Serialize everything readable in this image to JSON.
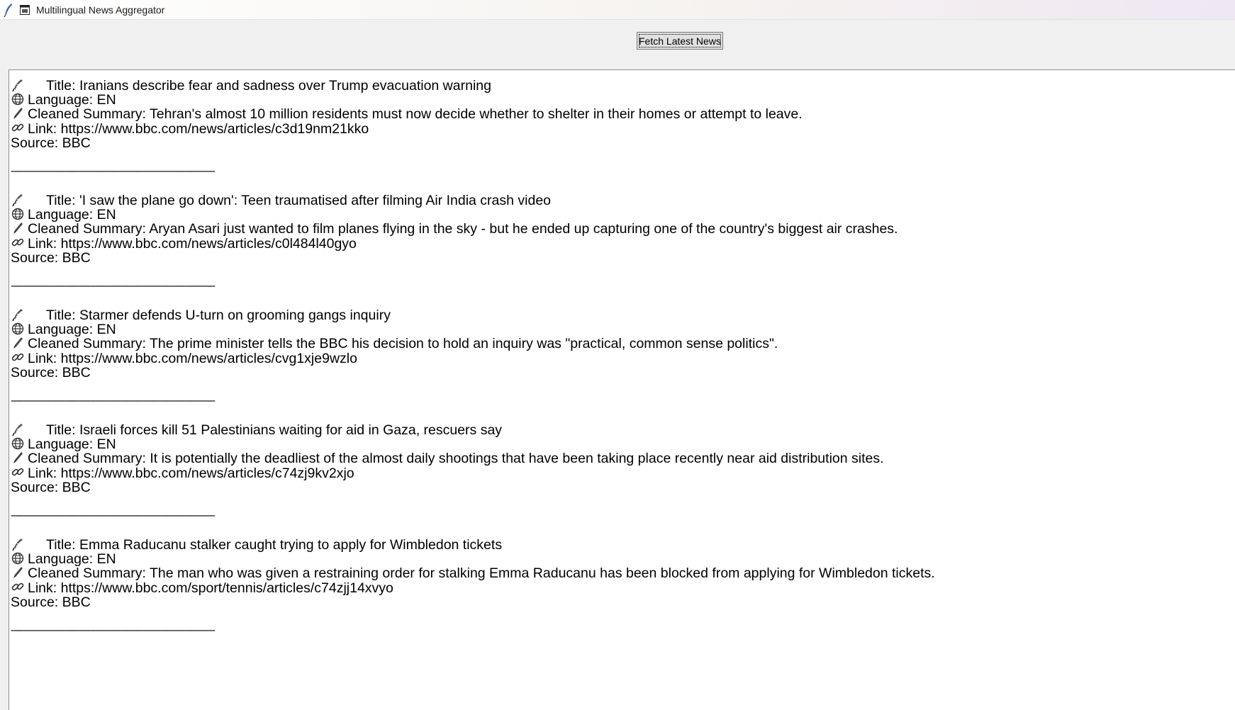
{
  "window": {
    "title": "Multilingual News Aggregator"
  },
  "toolbar": {
    "fetch_label": "Fetch Latest News"
  },
  "labels": {
    "title": "Title:",
    "language": "Language:",
    "summary": "Cleaned Summary:",
    "link": "Link:",
    "source": "Source:"
  },
  "icons": {
    "title": "feather-quill-icon",
    "language": "globe-icon",
    "summary": "pen-icon",
    "link": "link-icon"
  },
  "separator": "--------------------------------------------------------------------------------",
  "articles": [
    {
      "title": "Iranians describe fear and sadness over Trump evacuation warning",
      "language": "EN",
      "summary": "Tehran's almost 10 million residents must now decide whether to shelter in their homes or attempt to leave.",
      "link": "https://www.bbc.com/news/articles/c3d19nm21kko",
      "source": "BBC"
    },
    {
      "title": "'I saw the plane go down': Teen traumatised after filming Air India crash video",
      "language": "EN",
      "summary": "Aryan Asari just wanted to film planes flying in the sky  - but he ended up capturing one of the country's biggest air crashes.",
      "link": "https://www.bbc.com/news/articles/c0l484l40gyo",
      "source": "BBC"
    },
    {
      "title": "Starmer defends U-turn on grooming gangs inquiry",
      "language": "EN",
      "summary": "The prime minister tells the BBC his decision to hold an inquiry was \"practical, common sense politics\".",
      "link": "https://www.bbc.com/news/articles/cvg1xje9wzlo",
      "source": "BBC"
    },
    {
      "title": "Israeli forces kill 51 Palestinians waiting for aid in Gaza, rescuers say",
      "language": "EN",
      "summary": "It is potentially the deadliest of the almost daily shootings that have been taking place recently near aid distribution sites.",
      "link": "https://www.bbc.com/news/articles/c74zj9kv2xjo",
      "source": "BBC"
    },
    {
      "title": "Emma Raducanu stalker caught trying to apply for Wimbledon tickets",
      "language": "EN",
      "summary": "The man who was given a restraining order for stalking Emma Raducanu has been blocked from applying for Wimbledon tickets.",
      "link": "https://www.bbc.com/sport/tennis/articles/c74zjj14xvyo",
      "source": "BBC"
    }
  ]
}
